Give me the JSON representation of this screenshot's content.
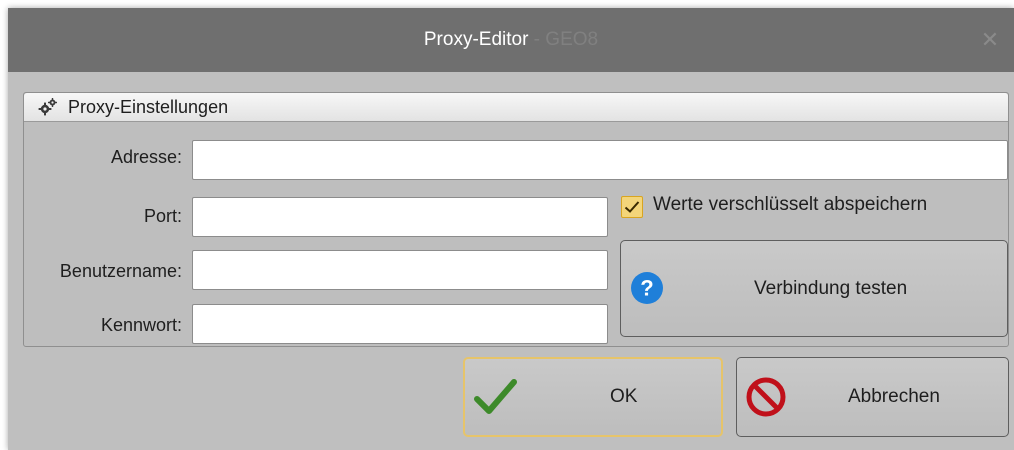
{
  "window": {
    "title": "Proxy-Editor",
    "title_separator": " - ",
    "app_name": "GEO8",
    "close_glyph": "✕"
  },
  "group": {
    "title": "Proxy-Einstellungen",
    "icon": "gears-icon"
  },
  "fields": {
    "address": {
      "label": "Adresse:",
      "value": ""
    },
    "port": {
      "label": "Port:",
      "value": ""
    },
    "username": {
      "label": "Benutzername:",
      "value": ""
    },
    "password": {
      "label": "Kennwort:",
      "value": ""
    }
  },
  "encrypt_option": {
    "label": "Werte verschlüsselt abspeichern",
    "checked": true
  },
  "buttons": {
    "test": {
      "label": "Verbindung testen",
      "icon": "question-icon"
    },
    "ok": {
      "label": "OK",
      "icon": "checkmark-icon"
    },
    "cancel": {
      "label": "Abbrechen",
      "icon": "prohibited-icon"
    }
  },
  "colors": {
    "titlebar": "#6f6f6f",
    "window_bg": "#bfbfbf",
    "checkbox_fill": "#f3d57a",
    "focus_border": "#e6c46a",
    "ok_check": "#3d8a2a",
    "cancel_red": "#c0101a",
    "help_blue": "#1f7fd9"
  }
}
